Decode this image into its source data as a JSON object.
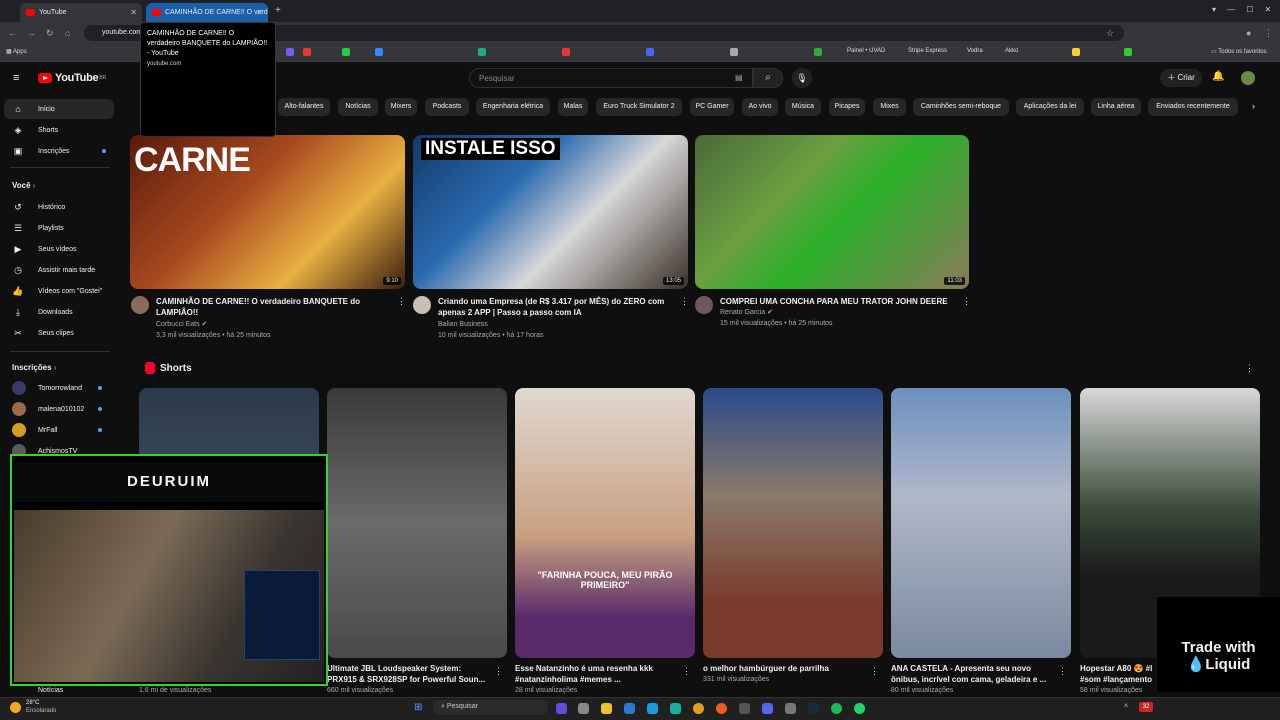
{
  "browser": {
    "tabs": [
      {
        "title": "YouTube",
        "active": true
      },
      {
        "title": "CAMINHÃO DE CARNE!! O verd",
        "active": false
      }
    ],
    "url": "youtube.com",
    "tooltip": {
      "title": "CAMINHÃO DE CARNE!! O verdadeiro BANQUETE do LAMPIÃO!! - YouTube",
      "domain": "youtube.com"
    },
    "bookmarks": {
      "apps_label": "Apps",
      "items": [
        "Painel • UVAD",
        "Stripe Express",
        "Vodra",
        "Akko"
      ],
      "all_favorites": "Todos os favoritos"
    }
  },
  "header": {
    "logo": "YouTube",
    "country": "BR",
    "search_placeholder": "Pesquisar",
    "create_label": "Criar"
  },
  "sidebar": {
    "main": [
      {
        "label": "Início",
        "icon": "home-icon"
      },
      {
        "label": "Shorts",
        "icon": "shorts-icon"
      },
      {
        "label": "Inscrições",
        "icon": "subscriptions-icon"
      }
    ],
    "you_heading": "Você",
    "you_items": [
      {
        "label": "Histórico",
        "icon": "history-icon"
      },
      {
        "label": "Playlists",
        "icon": "playlist-icon"
      },
      {
        "label": "Seus vídeos",
        "icon": "video-icon"
      },
      {
        "label": "Assistir mais tarde",
        "icon": "clock-icon"
      },
      {
        "label": "Vídeos com \"Gostei\"",
        "icon": "thumbs-up-icon"
      },
      {
        "label": "Downloads",
        "icon": "download-icon"
      },
      {
        "label": "Seus clipes",
        "icon": "scissors-icon"
      }
    ],
    "subs_heading": "Inscrições",
    "subscriptions": [
      {
        "name": "Tomorrowland",
        "color": "#3a3a6a"
      },
      {
        "name": "malena010102",
        "color": "#9a6a4a"
      },
      {
        "name": "MrFall",
        "color": "#d4a020"
      },
      {
        "name": "AchismosTV",
        "color": "#5a5a5a"
      }
    ],
    "bottom_item": "Notícias"
  },
  "chips": [
    "Alto-falantes",
    "Notícias",
    "Mixers",
    "Podcasts",
    "Engenharia elétrica",
    "Malas",
    "Euro Truck Simulator 2",
    "PC Gamer",
    "Ao vivo",
    "Música",
    "Picapes",
    "Mixes",
    "Caminhões semi-reboque",
    "Aplicações da lei",
    "Linha aérea",
    "Enviados recentemente"
  ],
  "videos": [
    {
      "title": "CAMINHÃO DE CARNE!! O verdadeiro BANQUETE do LAMPIÃO!!",
      "channel": "Corbucci Eats",
      "verified": "✔",
      "meta": "3,3 mil visualizações • há 25 minutos",
      "duration": "9:10",
      "thumb_text": "CARNE"
    },
    {
      "title": "Criando uma Empresa (de R$ 3.417 por MÊS) do ZERO com apenas 2 APP | Passo a passo com IA",
      "channel": "Balian Business",
      "verified": "",
      "meta": "10 mil visualizações • há 17 horas",
      "duration": "13:05",
      "thumb_text": "INSTALE ISSO"
    },
    {
      "title": "COMPREI UMA CONCHA PARA MEU TRATOR JOHN DEERE",
      "channel": "Renato Garcia",
      "verified": "✔",
      "meta": "15 mil visualizações • há 25 minutos",
      "duration": "11:03",
      "thumb_text": ""
    }
  ],
  "shorts_heading": "Shorts",
  "shorts": [
    {
      "title": "",
      "views": "1,6 mi de visualizações"
    },
    {
      "title": "Ultimate JBL Loudspeaker System: PRX915 & SRX928SP for Powerful Soun...",
      "views": "660 mil visualizações"
    },
    {
      "title": "Esse Natanzinho é uma resenha kkk #natanzinholima #memes ...",
      "views": "28 mil visualizações",
      "overlay": "\"FARINHA POUCA, MEU PIRÃO PRIMEIRO\""
    },
    {
      "title": "o melhor hambúrguer de parrilha",
      "views": "331 mil visualizações"
    },
    {
      "title": "ANA CASTELA - Apresenta seu novo ônibus, incrível com cama, geladeira e ...",
      "views": "80 mil visualizações"
    },
    {
      "title": "Hopestar A80 😍 #l #som #lançamento",
      "views": "58 mil visualizações"
    }
  ],
  "overlay": {
    "webcam_label": "DEURUIM",
    "ad_line1": "Trade with",
    "ad_line2": "Liquid"
  },
  "taskbar": {
    "weather_temp": "28°C",
    "weather_desc": "Ensolarado",
    "search_placeholder": "Pesquisar",
    "notification_count": "32"
  }
}
